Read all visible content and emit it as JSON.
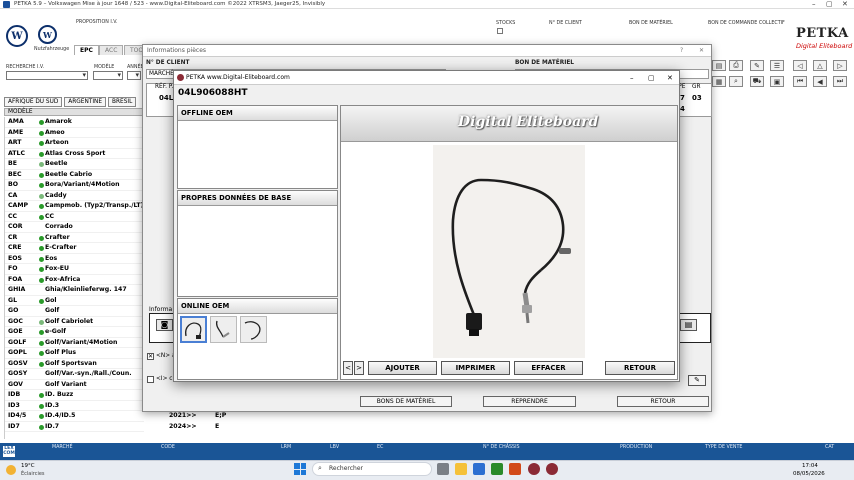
{
  "main_window": {
    "title": "PETKA 5.9 – Volkswagen Mise à jour 1648 / 523 - www.Digital-Eliteboard.com ©2022 XTRSM3, Jaeger25, Invisibly",
    "brand": "PETKA",
    "brand_sub": "Digital Eliteboard",
    "nutz_label": "Nutzfahrzeuge",
    "tabs": [
      "EPC",
      "ACC",
      "TOOL"
    ],
    "header_labels": {
      "proposition": "PROPOSITION I.V.",
      "stocks": "STOCKS",
      "client_no": "N° DE CLIENT",
      "bon_materiel": "BON DE MATÉRIEL",
      "bon_commande": "BON DE COMMANDE COLLECTIF",
      "recherche": "RECHERCHE I.V.",
      "modele": "MODÈLE",
      "annee": "ANNÉE"
    },
    "country_tabs": [
      "AFRIQUE DU SUD",
      "ARGENTINE",
      "BRESIL"
    ],
    "model_header": "MODÈLE",
    "models": [
      {
        "code": "AMA",
        "name": "Amarok",
        "dot": "#2a9a2a"
      },
      {
        "code": "AME",
        "name": "Ameo",
        "dot": "#2a9a2a"
      },
      {
        "code": "ART",
        "name": "Arteon",
        "dot": "#2a9a2a"
      },
      {
        "code": "ATLC",
        "name": "Atlas Cross Sport",
        "dot": "#2a9a2a"
      },
      {
        "code": "BE",
        "name": "Beetle",
        "dot": "#7ab87a"
      },
      {
        "code": "BEC",
        "name": "Beetle Cabrio",
        "dot": "#2a9a2a"
      },
      {
        "code": "BO",
        "name": "Bora/Variant/4Motion",
        "dot": "#2a9a2a"
      },
      {
        "code": "CA",
        "name": "Caddy",
        "dot": "#7ab87a"
      },
      {
        "code": "CAMP",
        "name": "Campmob. (Typ2/Transp./LT)",
        "dot": "#2a9a2a"
      },
      {
        "code": "CC",
        "name": "CC",
        "dot": "#2a9a2a"
      },
      {
        "code": "COR",
        "name": "Corrado",
        "dot": ""
      },
      {
        "code": "CR",
        "name": "Crafter",
        "dot": "#2a9a2a"
      },
      {
        "code": "CRE",
        "name": "E-Crafter",
        "dot": "#2a9a2a"
      },
      {
        "code": "EOS",
        "name": "Eos",
        "dot": "#2a9a2a"
      },
      {
        "code": "FO",
        "name": "Fox-EU",
        "dot": "#2a9a2a"
      },
      {
        "code": "FOA",
        "name": "Fox-Africa",
        "dot": "#2a9a2a"
      },
      {
        "code": "GHIA",
        "name": "Ghia/Kleinlieferwg. 147",
        "dot": ""
      },
      {
        "code": "GL",
        "name": "Gol",
        "dot": "#2a9a2a"
      },
      {
        "code": "GO",
        "name": "Golf",
        "dot": ""
      },
      {
        "code": "GOC",
        "name": "Golf Cabriolet",
        "dot": "#7ab87a"
      },
      {
        "code": "GOE",
        "name": "e-Golf",
        "dot": "#2a9a2a"
      },
      {
        "code": "GOLF",
        "name": "Golf/Variant/4Motion",
        "dot": "#2a9a2a"
      },
      {
        "code": "GOPL",
        "name": "Golf Plus",
        "dot": "#2a9a2a"
      },
      {
        "code": "GOSV",
        "name": "Golf Sportsvan",
        "dot": "#2a9a2a"
      },
      {
        "code": "GOSY",
        "name": "Golf/Var.-syn./Rall./Coun.",
        "dot": ""
      },
      {
        "code": "GOV",
        "name": "Golf Variant",
        "dot": ""
      },
      {
        "code": "IDB",
        "name": "ID. Buzz",
        "dot": "#2a9a2a"
      },
      {
        "code": "ID3",
        "name": "ID.3",
        "dot": "#2a9a2a"
      },
      {
        "code": "ID4/5",
        "name": "ID.4/ID.5",
        "dot": "#2a9a2a"
      },
      {
        "code": "ID7",
        "name": "ID.7",
        "dot": "#2a9a2a"
      }
    ],
    "model_years": [
      {
        "row": 28,
        "year": "2021>>",
        "engine": "E;P"
      },
      {
        "row": 29,
        "year": "2024>>",
        "engine": "E"
      }
    ],
    "status_labels": [
      "MARCHÉ",
      "CODE",
      "LRM",
      "LBV",
      "EC",
      "N° DE CHÂSSIS",
      "PRODUCTION",
      "TYPE DE VENTE",
      "CAT"
    ]
  },
  "info_window": {
    "title": "Informations pièces",
    "client_label": "N° DE CLIENT",
    "bon_label": "BON DE MATÉRIEL",
    "market_label": "MARCHÉ",
    "ref_label": "RÉF. P.",
    "ref_value": "04L",
    "col_labels": [
      "Y.PE",
      "GR"
    ],
    "col_values": [
      "7",
      "03"
    ],
    "col_value_2": "4",
    "info_label": "Informa",
    "check1_label": "<N> ac",
    "check2_label": "<I> ch",
    "buttons": [
      "BONS DE MATÉRIEL",
      "REPRENDRE",
      "RETOUR"
    ]
  },
  "viewer": {
    "title": "PETKA www.Digital-Eliteboard.com",
    "part_number": "04L906088HT",
    "panel_offline": "OFFLINE OEM",
    "panel_base": "PROPRES DONNÉES DE BASE",
    "panel_online": "ONLINE OEM",
    "banner": "Digital Eliteboard",
    "nav_prev": "<",
    "nav_next": ">",
    "buttons": [
      "AJOUTER",
      "IMPRIMER",
      "EFFACER",
      "RETOUR"
    ]
  },
  "taskbar": {
    "weather_temp": "19°C",
    "weather_desc": "Éclaircies",
    "search_placeholder": "Rechercher",
    "time": "17:04",
    "date": "08/05/2026"
  },
  "colors": {
    "statusbar": "#1a5596",
    "brand_red": "#c00000",
    "vw_blue": "#0c2f6b"
  }
}
